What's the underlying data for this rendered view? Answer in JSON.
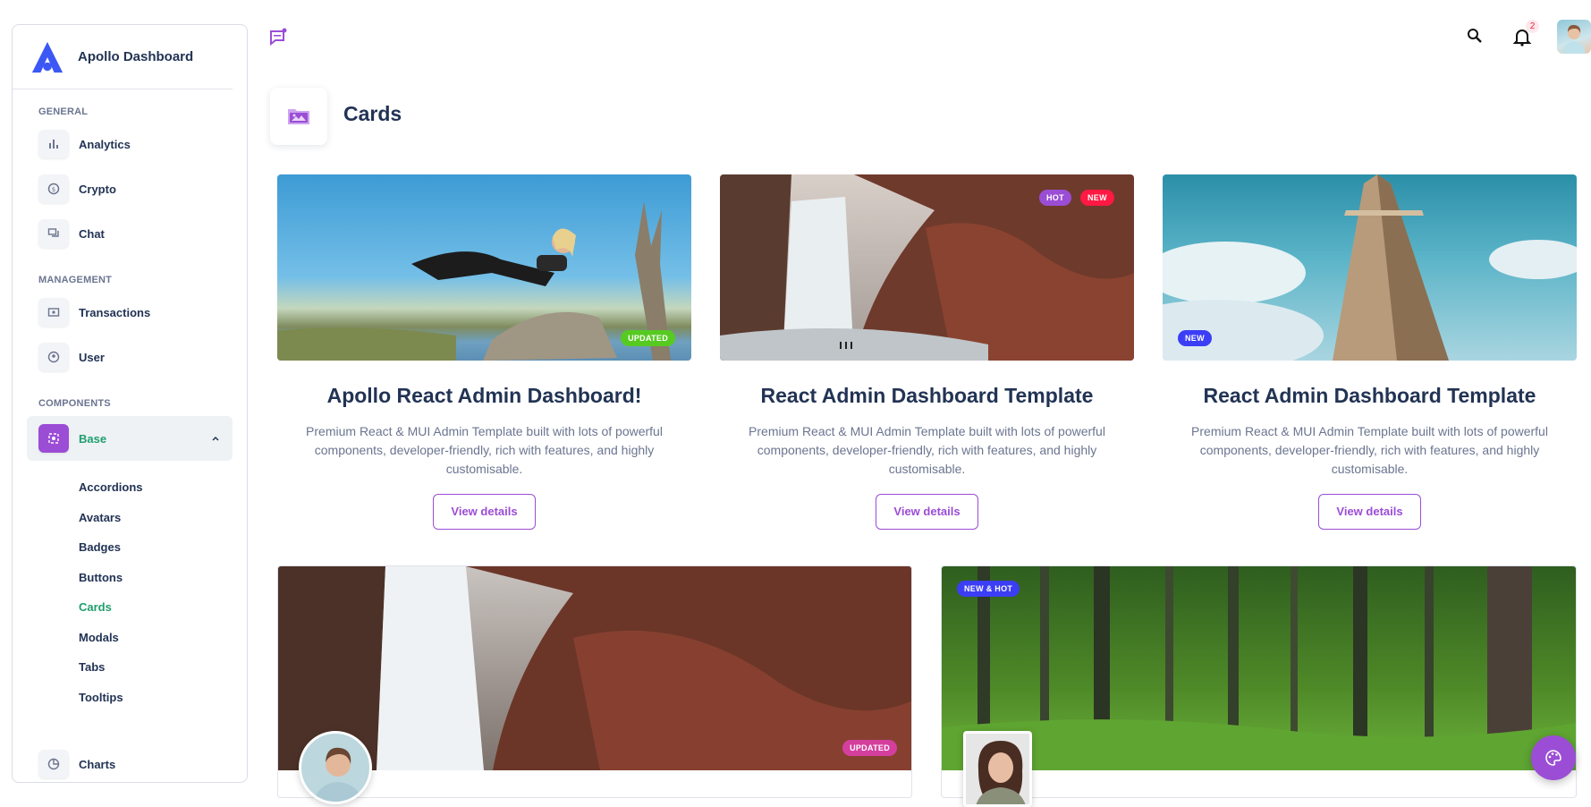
{
  "brand": {
    "name": "Apollo Dashboard"
  },
  "sidebar": {
    "sections": [
      {
        "title": "GENERAL",
        "items": [
          {
            "label": "Analytics",
            "icon": "bar-chart-icon"
          },
          {
            "label": "Crypto",
            "icon": "coin-icon"
          },
          {
            "label": "Chat",
            "icon": "chat-icon"
          }
        ]
      },
      {
        "title": "MANAGEMENT",
        "items": [
          {
            "label": "Transactions",
            "icon": "receipt-icon"
          },
          {
            "label": "User",
            "icon": "user-circle-icon"
          }
        ]
      },
      {
        "title": "COMPONENTS",
        "items": [
          {
            "label": "Base",
            "icon": "base-icon"
          }
        ]
      }
    ],
    "base_subitems": [
      "Accordions",
      "Avatars",
      "Badges",
      "Buttons",
      "Cards",
      "Modals",
      "Tabs",
      "Tooltips"
    ],
    "active_subitem": "Cards",
    "charts_label": "Charts"
  },
  "topbar": {
    "notification_count": "2"
  },
  "page": {
    "title": "Cards"
  },
  "cards": [
    {
      "title": "Apollo React Admin Dashboard!",
      "description": "Premium React & MUI Admin Template built with lots of powerful components, developer-friendly, rich with features, and highly customisable.",
      "button": "View details",
      "tags": [
        "UPDATED"
      ]
    },
    {
      "title": "React Admin Dashboard Template",
      "description": "Premium React & MUI Admin Template built with lots of powerful components, developer-friendly, rich with features, and highly customisable.",
      "button": "View details",
      "tags": [
        "HOT",
        "NEW"
      ]
    },
    {
      "title": "React Admin Dashboard Template",
      "description": "Premium React & MUI Admin Template built with lots of powerful components, developer-friendly, rich with features, and highly customisable.",
      "button": "View details",
      "tags": [
        "NEW"
      ]
    }
  ],
  "bigcards": [
    {
      "tag": "UPDATED"
    },
    {
      "tag": "NEW & HOT"
    }
  ],
  "colors": {
    "accent": "#9b4dd6",
    "active_text": "#1f9e6e",
    "tag_green": "#57ca22",
    "tag_red": "#ff1943",
    "tag_blue": "#3b3ef5",
    "tag_pink": "#d43f9e"
  }
}
